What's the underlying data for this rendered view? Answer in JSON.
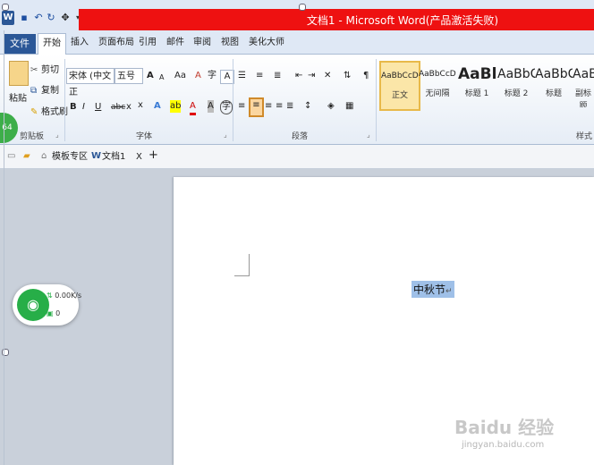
{
  "window": {
    "title": "文档1 - Microsoft Word(产品激活失败)",
    "logo": "W"
  },
  "tabs": {
    "file": "文件",
    "items": [
      "开始",
      "插入",
      "页面布局",
      "引用",
      "邮件",
      "审阅",
      "视图",
      "美化大师"
    ]
  },
  "clipboard": {
    "paste": "粘贴",
    "cut": "剪切",
    "copy": "复制",
    "format_painter": "格式刷",
    "label": "剪贴板"
  },
  "font": {
    "name": "宋体 (中文正",
    "size": "五号",
    "grow": "A",
    "shrink": "A",
    "case": "Aa",
    "clear": "A",
    "pinyin": "字",
    "border": "A",
    "bold": "B",
    "italic": "I",
    "underline": "U",
    "strike": "abc",
    "sub": "x",
    "sup": "x",
    "effects": "A",
    "highlight": "ab",
    "color": "A",
    "shade": "A",
    "enclose": "字",
    "label": "字体"
  },
  "paragraph": {
    "label": "段落"
  },
  "styles": {
    "label": "样式",
    "items": [
      {
        "sample": "AaBbCcDd",
        "name": "正文"
      },
      {
        "sample": "AaBbCcDd",
        "name": "无间隔"
      },
      {
        "sample": "AaBb",
        "name": "标题 1"
      },
      {
        "sample": "AaBbC",
        "name": "标题 2"
      },
      {
        "sample": "AaBbC",
        "name": "标题"
      },
      {
        "sample": "AaBl",
        "name": "副标题"
      }
    ]
  },
  "doc_tabs": {
    "template": "模板专区",
    "doc": "文档1",
    "close": "X",
    "add": "+"
  },
  "document": {
    "text": "中秋节",
    "para_mark": "↵"
  },
  "network_widget": {
    "speed": "0.00K/s",
    "count": "0"
  },
  "badge": "64",
  "watermark": {
    "text": "Baidu 经验",
    "url": "jingyan.baidu.com"
  },
  "colors": {
    "title_bar": "#ee1111",
    "file_tab": "#2b5797",
    "selection": "#9fc0e8",
    "wifi": "#27ae48"
  }
}
